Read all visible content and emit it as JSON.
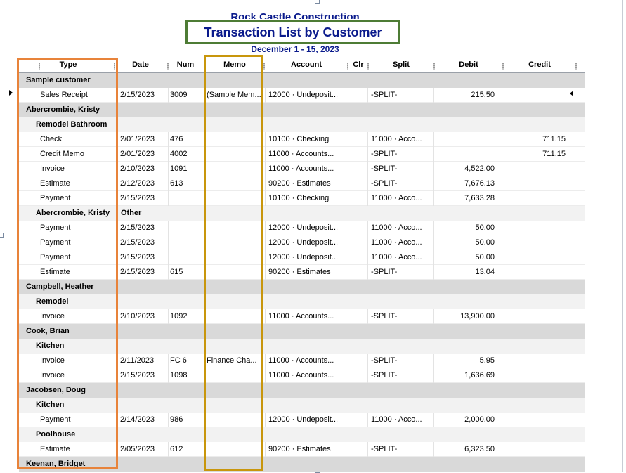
{
  "report": {
    "company": "Rock Castle Construction",
    "title": "Transaction List by Customer",
    "date_range": "December 1 - 15, 2023"
  },
  "columns": {
    "type": "Type",
    "date": "Date",
    "num": "Num",
    "memo": "Memo",
    "account": "Account",
    "clr": "Clr",
    "split": "Split",
    "debit": "Debit",
    "credit": "Credit"
  },
  "rows": [
    {
      "kind": "group",
      "label": "Sample customer"
    },
    {
      "kind": "txn",
      "type": "Sales Receipt",
      "date": "2/15/2023",
      "num": "3009",
      "memo": "(Sample Mem...",
      "account": "12000 · Undeposit...",
      "clr": "",
      "split": "-SPLIT-",
      "debit": "215.50",
      "credit": ""
    },
    {
      "kind": "group",
      "label": "Abercrombie, Kristy"
    },
    {
      "kind": "subgroup",
      "label": "Remodel Bathroom"
    },
    {
      "kind": "txn",
      "type": "Check",
      "date": "2/01/2023",
      "num": "476",
      "memo": "",
      "account": "10100 · Checking",
      "clr": "",
      "split": "11000 · Acco...",
      "debit": "",
      "credit": "711.15"
    },
    {
      "kind": "txn",
      "type": "Credit Memo",
      "date": "2/01/2023",
      "num": "4002",
      "memo": "",
      "account": "11000 · Accounts...",
      "clr": "",
      "split": "-SPLIT-",
      "debit": "",
      "credit": "711.15"
    },
    {
      "kind": "txn",
      "type": "Invoice",
      "date": "2/10/2023",
      "num": "1091",
      "memo": "",
      "account": "11000 · Accounts...",
      "clr": "",
      "split": "-SPLIT-",
      "debit": "4,522.00",
      "credit": ""
    },
    {
      "kind": "txn",
      "type": "Estimate",
      "date": "2/12/2023",
      "num": "613",
      "memo": "",
      "account": "90200 · Estimates",
      "clr": "",
      "split": "-SPLIT-",
      "debit": "7,676.13",
      "credit": ""
    },
    {
      "kind": "txn",
      "type": "Payment",
      "date": "2/15/2023",
      "num": "",
      "memo": "",
      "account": "10100 · Checking",
      "clr": "",
      "split": "11000 · Acco...",
      "debit": "7,633.28",
      "credit": ""
    },
    {
      "kind": "subgroup",
      "label": "Abercrombie, Kristy",
      "label2": "Other"
    },
    {
      "kind": "txn",
      "type": "Payment",
      "date": "2/15/2023",
      "num": "",
      "memo": "",
      "account": "12000 · Undeposit...",
      "clr": "",
      "split": "11000 · Acco...",
      "debit": "50.00",
      "credit": ""
    },
    {
      "kind": "txn",
      "type": "Payment",
      "date": "2/15/2023",
      "num": "",
      "memo": "",
      "account": "12000 · Undeposit...",
      "clr": "",
      "split": "11000 · Acco...",
      "debit": "50.00",
      "credit": ""
    },
    {
      "kind": "txn",
      "type": "Payment",
      "date": "2/15/2023",
      "num": "",
      "memo": "",
      "account": "12000 · Undeposit...",
      "clr": "",
      "split": "11000 · Acco...",
      "debit": "50.00",
      "credit": ""
    },
    {
      "kind": "txn",
      "type": "Estimate",
      "date": "2/15/2023",
      "num": "615",
      "memo": "",
      "account": "90200 · Estimates",
      "clr": "",
      "split": "-SPLIT-",
      "debit": "13.04",
      "credit": ""
    },
    {
      "kind": "group",
      "label": "Campbell, Heather"
    },
    {
      "kind": "subgroup",
      "label": "Remodel"
    },
    {
      "kind": "txn",
      "type": "Invoice",
      "date": "2/10/2023",
      "num": "1092",
      "memo": "",
      "account": "11000 · Accounts...",
      "clr": "",
      "split": "-SPLIT-",
      "debit": "13,900.00",
      "credit": ""
    },
    {
      "kind": "group",
      "label": "Cook, Brian"
    },
    {
      "kind": "subgroup",
      "label": "Kitchen"
    },
    {
      "kind": "txn",
      "type": "Invoice",
      "date": "2/11/2023",
      "num": "FC 6",
      "memo": "Finance Cha...",
      "account": "11000 · Accounts...",
      "clr": "",
      "split": "-SPLIT-",
      "debit": "5.95",
      "credit": ""
    },
    {
      "kind": "txn",
      "type": "Invoice",
      "date": "2/15/2023",
      "num": "1098",
      "memo": "",
      "account": "11000 · Accounts...",
      "clr": "",
      "split": "-SPLIT-",
      "debit": "1,636.69",
      "credit": ""
    },
    {
      "kind": "group",
      "label": "Jacobsen, Doug"
    },
    {
      "kind": "subgroup",
      "label": "Kitchen"
    },
    {
      "kind": "txn",
      "type": "Payment",
      "date": "2/14/2023",
      "num": "986",
      "memo": "",
      "account": "12000 · Undeposit...",
      "clr": "",
      "split": "11000 · Acco...",
      "debit": "2,000.00",
      "credit": ""
    },
    {
      "kind": "subgroup",
      "label": "Poolhouse"
    },
    {
      "kind": "txn",
      "type": "Estimate",
      "date": "2/05/2023",
      "num": "612",
      "memo": "",
      "account": "90200 · Estimates",
      "clr": "",
      "split": "-SPLIT-",
      "debit": "6,323.50",
      "credit": ""
    },
    {
      "kind": "group",
      "label": "Keenan, Bridget"
    }
  ],
  "colors": {
    "title_text": "#0a1a8c",
    "title_box": "#4e7c35",
    "type_highlight": "#e8833a",
    "memo_highlight": "#c8960c",
    "group_row": "#d9d9d9",
    "subgroup_row": "#f2f2f2"
  }
}
